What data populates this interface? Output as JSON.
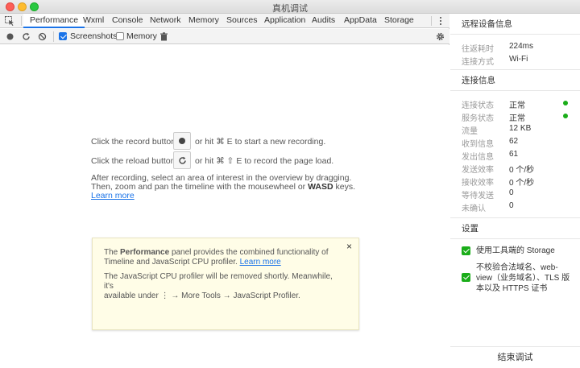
{
  "window": {
    "title": "真机调试"
  },
  "tabs": [
    {
      "label": "Performance",
      "active": true
    },
    {
      "label": "Wxml"
    },
    {
      "label": "Console"
    },
    {
      "label": "Network"
    },
    {
      "label": "Memory"
    },
    {
      "label": "Sources"
    },
    {
      "label": "Application"
    },
    {
      "label": "Audits"
    },
    {
      "label": "AppData"
    },
    {
      "label": "Storage"
    }
  ],
  "toolbar": {
    "screenshots_label": "Screenshots",
    "screenshots_checked": true,
    "memory_label": "Memory",
    "memory_checked": false
  },
  "main": {
    "record_pre": "Click the record button",
    "record_post": "or hit ⌘ E to start a new recording.",
    "reload_pre": "Click the reload button",
    "reload_post": "or hit ⌘ ⇧ E to record the page load.",
    "hint_line1": "After recording, select an area of interest in the overview by dragging.",
    "hint_line2_pre": "Then, zoom and pan the timeline with the mousewheel or",
    "hint_line2_bold": "WASD",
    "hint_line2_post": "keys.",
    "learn_more": "Learn more"
  },
  "notice": {
    "p1_pre": "The",
    "p1_bold": "Performance",
    "p1_mid": "panel provides the combined functionality of",
    "p1_line2": "Timeline and JavaScript CPU profiler.",
    "p1_link": "Learn more",
    "p2_line1": "The JavaScript CPU profiler will be removed shortly. Meanwhile, it's",
    "p2_line2": "available under ⋮ → More Tools → JavaScript Profiler.",
    "close": "×"
  },
  "panel": {
    "device_title": "远程设备信息",
    "device_rows": [
      {
        "key": "往返耗时",
        "value": "224ms"
      },
      {
        "key": "连接方式",
        "value": "Wi-Fi"
      }
    ],
    "conn_title": "连接信息",
    "conn_rows": [
      {
        "key": "连接状态",
        "value": "正常",
        "dot": true
      },
      {
        "key": "服务状态",
        "value": "正常",
        "dot": true
      },
      {
        "key": "流量",
        "value": "12 KB"
      },
      {
        "key": "收到信息",
        "value": "62"
      },
      {
        "key": "发出信息",
        "value": "61"
      },
      {
        "key": "发送效率",
        "value": "0 个/秒"
      },
      {
        "key": "接收效率",
        "value": "0 个/秒"
      },
      {
        "key": "等待发送",
        "value": "0"
      },
      {
        "key": "未确认",
        "value": "0"
      }
    ],
    "settings_title": "设置",
    "settings": [
      {
        "label": "使用工具端的 Storage",
        "checked": true
      },
      {
        "label": "不校验合法域名、web-view（业务域名）、TLS 版本以及 HTTPS 证书",
        "checked": true
      }
    ],
    "end_button": "结束调试"
  },
  "colors": {
    "accent": "#1a73e8",
    "green": "#1aad19"
  }
}
